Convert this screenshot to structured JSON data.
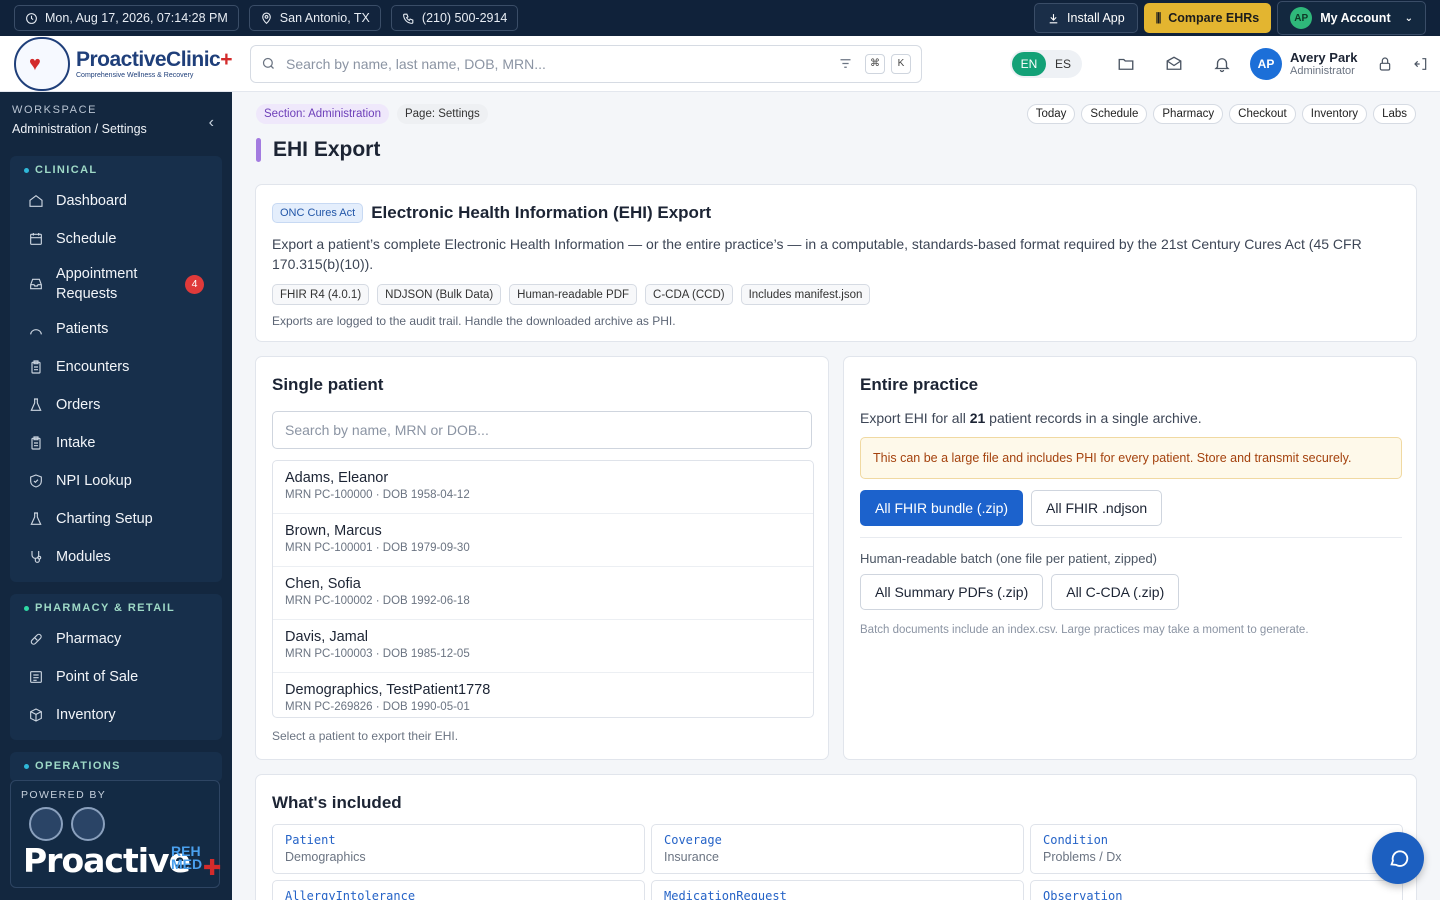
{
  "topbar": {
    "datetime": "Mon, Aug 17, 2026, 07:14:28 PM",
    "location": "San Antonio, TX",
    "phone": "(210) 500-2914",
    "install_label": "Install App",
    "compare_label": "Compare EHRs",
    "account_initials": "AP",
    "account_label": "My Account"
  },
  "header": {
    "logo_name": "ProactiveClinic",
    "logo_plus": "+",
    "logo_tagline": "Comprehensive Wellness & Recovery",
    "search_placeholder": "Search by name, last name, DOB, MRN...",
    "kbd_cmd": "⌘",
    "kbd_k": "K",
    "lang_en": "EN",
    "lang_es": "ES",
    "user_initials": "AP",
    "user_name": "Avery Park",
    "user_role": "Administrator"
  },
  "sidebar": {
    "workspace_label": "WORKSPACE",
    "workspace_path": "Administration / Settings",
    "clinical_label": "CLINICAL",
    "clinical_items": [
      {
        "label": "Dashboard",
        "icon": "home-icon"
      },
      {
        "label": "Schedule",
        "icon": "calendar-icon"
      },
      {
        "label": "Appointment Requests",
        "icon": "inbox-icon",
        "badge": "4"
      },
      {
        "label": "Patients",
        "icon": "users-icon"
      },
      {
        "label": "Encounters",
        "icon": "clipboard-icon"
      },
      {
        "label": "Orders",
        "icon": "flask-icon"
      },
      {
        "label": "Intake",
        "icon": "clipboard-icon"
      },
      {
        "label": "NPI Lookup",
        "icon": "shield-icon"
      },
      {
        "label": "Charting Setup",
        "icon": "flask-icon"
      },
      {
        "label": "Modules",
        "icon": "stethoscope-icon"
      }
    ],
    "pharmacy_label": "PHARMACY & RETAIL",
    "pharmacy_items": [
      {
        "label": "Pharmacy",
        "icon": "pill-icon"
      },
      {
        "label": "Point of Sale",
        "icon": "receipt-icon"
      },
      {
        "label": "Inventory",
        "icon": "box-icon"
      }
    ],
    "operations_label": "OPERATIONS",
    "powered_label": "POWERED BY",
    "powered_name": "Proactive",
    "powered_reh": "REH",
    "powered_med": "MED"
  },
  "main": {
    "crumb_section": "Section: Administration",
    "crumb_page": "Page: Settings",
    "quick_links": [
      "Today",
      "Schedule",
      "Pharmacy",
      "Checkout",
      "Inventory",
      "Labs"
    ],
    "page_title": "EHI Export"
  },
  "ehi": {
    "badge": "ONC Cures Act",
    "title": "Electronic Health Information (EHI) Export",
    "description": "Export a patient’s complete Electronic Health Information — or the entire practice’s — in a computable, standards-based format required by the 21st Century Cures Act (45 CFR 170.315(b)(10)).",
    "formats": [
      "FHIR R4 (4.0.1)",
      "NDJSON (Bulk Data)",
      "Human-readable PDF",
      "C-CDA (CCD)",
      "Includes manifest.json"
    ],
    "note": "Exports are logged to the audit trail. Handle the downloaded archive as PHI."
  },
  "single": {
    "title": "Single patient",
    "search_placeholder": "Search by name, MRN or DOB...",
    "patients": [
      {
        "name": "Adams, Eleanor",
        "meta": "MRN PC-100000 · DOB 1958-04-12"
      },
      {
        "name": "Brown, Marcus",
        "meta": "MRN PC-100001 · DOB 1979-09-30"
      },
      {
        "name": "Chen, Sofia",
        "meta": "MRN PC-100002 · DOB 1992-06-18"
      },
      {
        "name": "Davis, Jamal",
        "meta": "MRN PC-100003 · DOB 1985-12-05"
      },
      {
        "name": "Demographics, TestPatient1778",
        "meta": "MRN PC-269826 · DOB 1990-05-01"
      }
    ],
    "help": "Select a patient to export their EHI."
  },
  "practice": {
    "title": "Entire practice",
    "desc_before": "Export EHI for all ",
    "count": "21",
    "desc_after": " patient records in a single archive.",
    "warning": "This can be a large file and includes PHI for every patient. Store and transmit securely.",
    "btn_fhir_zip": "All FHIR bundle (.zip)",
    "btn_fhir_ndjson": "All FHIR .ndjson",
    "batch_label": "Human-readable batch (one file per patient, zipped)",
    "btn_pdfs": "All Summary PDFs (.zip)",
    "btn_ccda": "All C-CDA (.zip)",
    "note": "Batch documents include an index.csv. Large practices may take a moment to generate."
  },
  "included": {
    "title": "What's included",
    "resources": [
      {
        "name": "Patient",
        "desc": "Demographics"
      },
      {
        "name": "Coverage",
        "desc": "Insurance"
      },
      {
        "name": "Condition",
        "desc": "Problems / Dx"
      },
      {
        "name": "AllergyIntolerance",
        "desc": ""
      },
      {
        "name": "MedicationRequest",
        "desc": ""
      },
      {
        "name": "Observation",
        "desc": ""
      }
    ]
  }
}
